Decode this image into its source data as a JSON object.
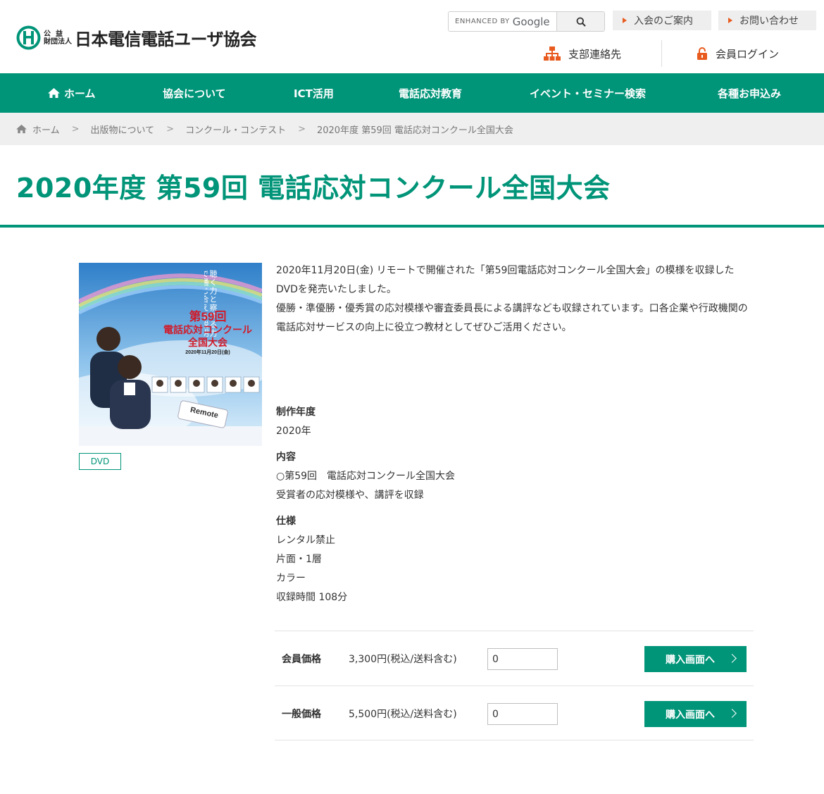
{
  "header": {
    "logo_sub_top": "公益",
    "logo_sub_bottom": "財団法人",
    "logo_main": "日本電信電話ユーザ協会",
    "search": {
      "enhanced_by": "ENHANCED BY",
      "brand": "Google"
    },
    "links": {
      "join": "入会のご案内",
      "contact": "お問い合わせ",
      "branch": "支部連絡先",
      "login": "会員ログイン"
    }
  },
  "nav": {
    "items": [
      {
        "label": "ホーム"
      },
      {
        "label": "協会について"
      },
      {
        "label": "ICT活用"
      },
      {
        "label": "電話応対教育"
      },
      {
        "label": "イベント・セミナー検索"
      },
      {
        "label": "各種お申込み"
      }
    ]
  },
  "breadcrumb": [
    {
      "label": "ホーム"
    },
    {
      "label": "出版物について"
    },
    {
      "label": "コンクール・コンテスト"
    },
    {
      "label": "2020年度 第59回 電話応対コンクール全国大会"
    }
  ],
  "page": {
    "title": "2020年度 第59回 電話応対コンクール全国大会"
  },
  "product": {
    "cover": {
      "tagline": "聴く力と察する力で通じ合える説明を",
      "line1": "第59回",
      "line2": "電話応対コンクール",
      "line3": "全国大会",
      "date": "2020年11月20日(金)",
      "badge": "Remote"
    },
    "format_badge": "DVD",
    "description_1": "2020年11月20日(金) リモートで開催された「第59回電話応対コンクール全国大会」の模様を収録したDVDを発売いたしました。",
    "description_2": "優勝・準優勝・優秀賞の応対模様や審査委員長による講評なども収録されています。口各企業や行政機関の電話応対サービスの向上に役立つ教材としてぜひご活用ください。",
    "specs": {
      "year_label": "制作年度",
      "year_value": "2020年",
      "content_label": "内容",
      "content_1": "○第59回　電話応対コンクール全国大会",
      "content_2": "受賞者の応対模様や、講評を収録",
      "spec_label": "仕様",
      "spec_1": "レンタル禁止",
      "spec_2": "片面・1層",
      "spec_3": "カラー",
      "spec_4": "収録時間 108分"
    },
    "prices": [
      {
        "label": "会員価格",
        "value": "3,300円(税込/送料含む)",
        "qty": "0",
        "button": "購入画面へ"
      },
      {
        "label": "一般価格",
        "value": "5,500円(税込/送料含む)",
        "qty": "0",
        "button": "購入画面へ"
      }
    ]
  },
  "colors": {
    "brand_green": "#009478",
    "accent_orange": "#e85a1d",
    "breadcrumb_bg": "#efefef"
  },
  "icons": {
    "home": "home-icon",
    "search": "search-icon",
    "branch": "org-chart-icon",
    "login": "lock-icon",
    "chevron": "chevron-right-icon"
  }
}
